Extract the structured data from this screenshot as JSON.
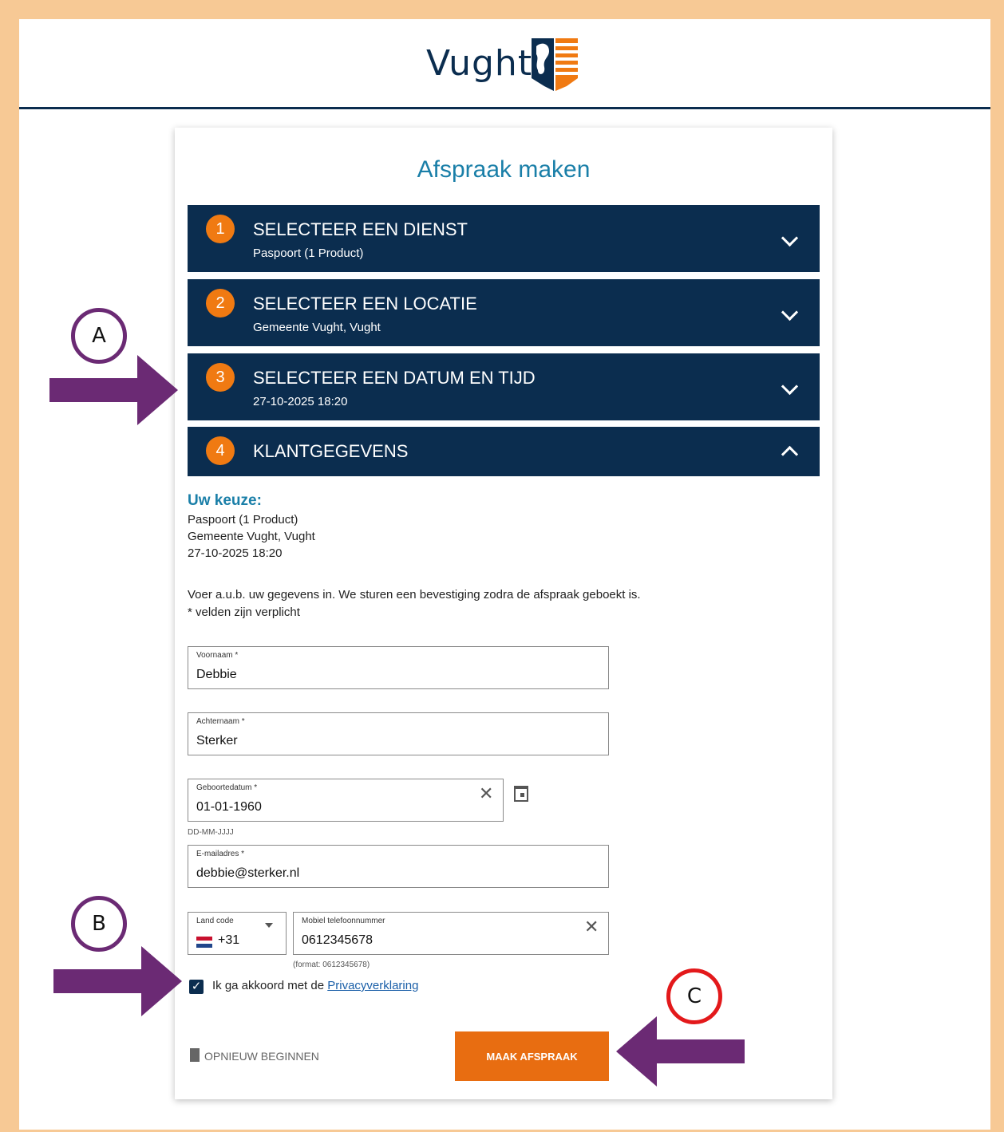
{
  "header": {
    "logo_text": "Vught"
  },
  "page": {
    "title": "Afspraak maken"
  },
  "steps": [
    {
      "number": "1",
      "title": "SELECTEER EEN DIENST",
      "subtitle": "Paspoort (1 Product)"
    },
    {
      "number": "2",
      "title": "SELECTEER EEN LOCATIE",
      "subtitle": "Gemeente Vught, Vught"
    },
    {
      "number": "3",
      "title": "SELECTEER EEN DATUM EN TIJD",
      "subtitle": "27-10-2025 18:20"
    },
    {
      "number": "4",
      "title": "KLANTGEGEVENS",
      "subtitle": ""
    }
  ],
  "summary": {
    "heading": "Uw keuze:",
    "lines": [
      "Paspoort (1 Product)",
      "Gemeente Vught, Vught",
      "27-10-2025 18:20"
    ]
  },
  "instructions": {
    "line1": "Voer a.u.b. uw gegevens in. We sturen een bevestiging zodra de afspraak geboekt is.",
    "line2": "* velden zijn verplicht"
  },
  "form": {
    "first_name": {
      "label": "Voornaam *",
      "value": "Debbie"
    },
    "last_name": {
      "label": "Achternaam *",
      "value": "Sterker"
    },
    "birthdate": {
      "label": "Geboortedatum *",
      "value": "01-01-1960",
      "hint": "DD-MM-JJJJ"
    },
    "email": {
      "label": "E-mailadres *",
      "value": "debbie@sterker.nl"
    },
    "country_code": {
      "label": "Land code",
      "value": "+31"
    },
    "phone": {
      "label": "Mobiel telefoonnummer",
      "value": "0612345678",
      "hint": "(format: 0612345678)"
    },
    "agree": {
      "text": "Ik ga akkoord met de ",
      "link": "Privacyverklaring",
      "checked": true
    }
  },
  "actions": {
    "reset": "OPNIEUW BEGINNEN",
    "submit": "MAAK AFSPRAAK"
  },
  "markers": {
    "a": "A",
    "b": "B",
    "c": "C"
  },
  "colors": {
    "navy": "#0b2d4f",
    "orange": "#e86d11",
    "teal": "#1a7fa8",
    "arrow": "#6b2a74",
    "frame": "#f7c995"
  }
}
